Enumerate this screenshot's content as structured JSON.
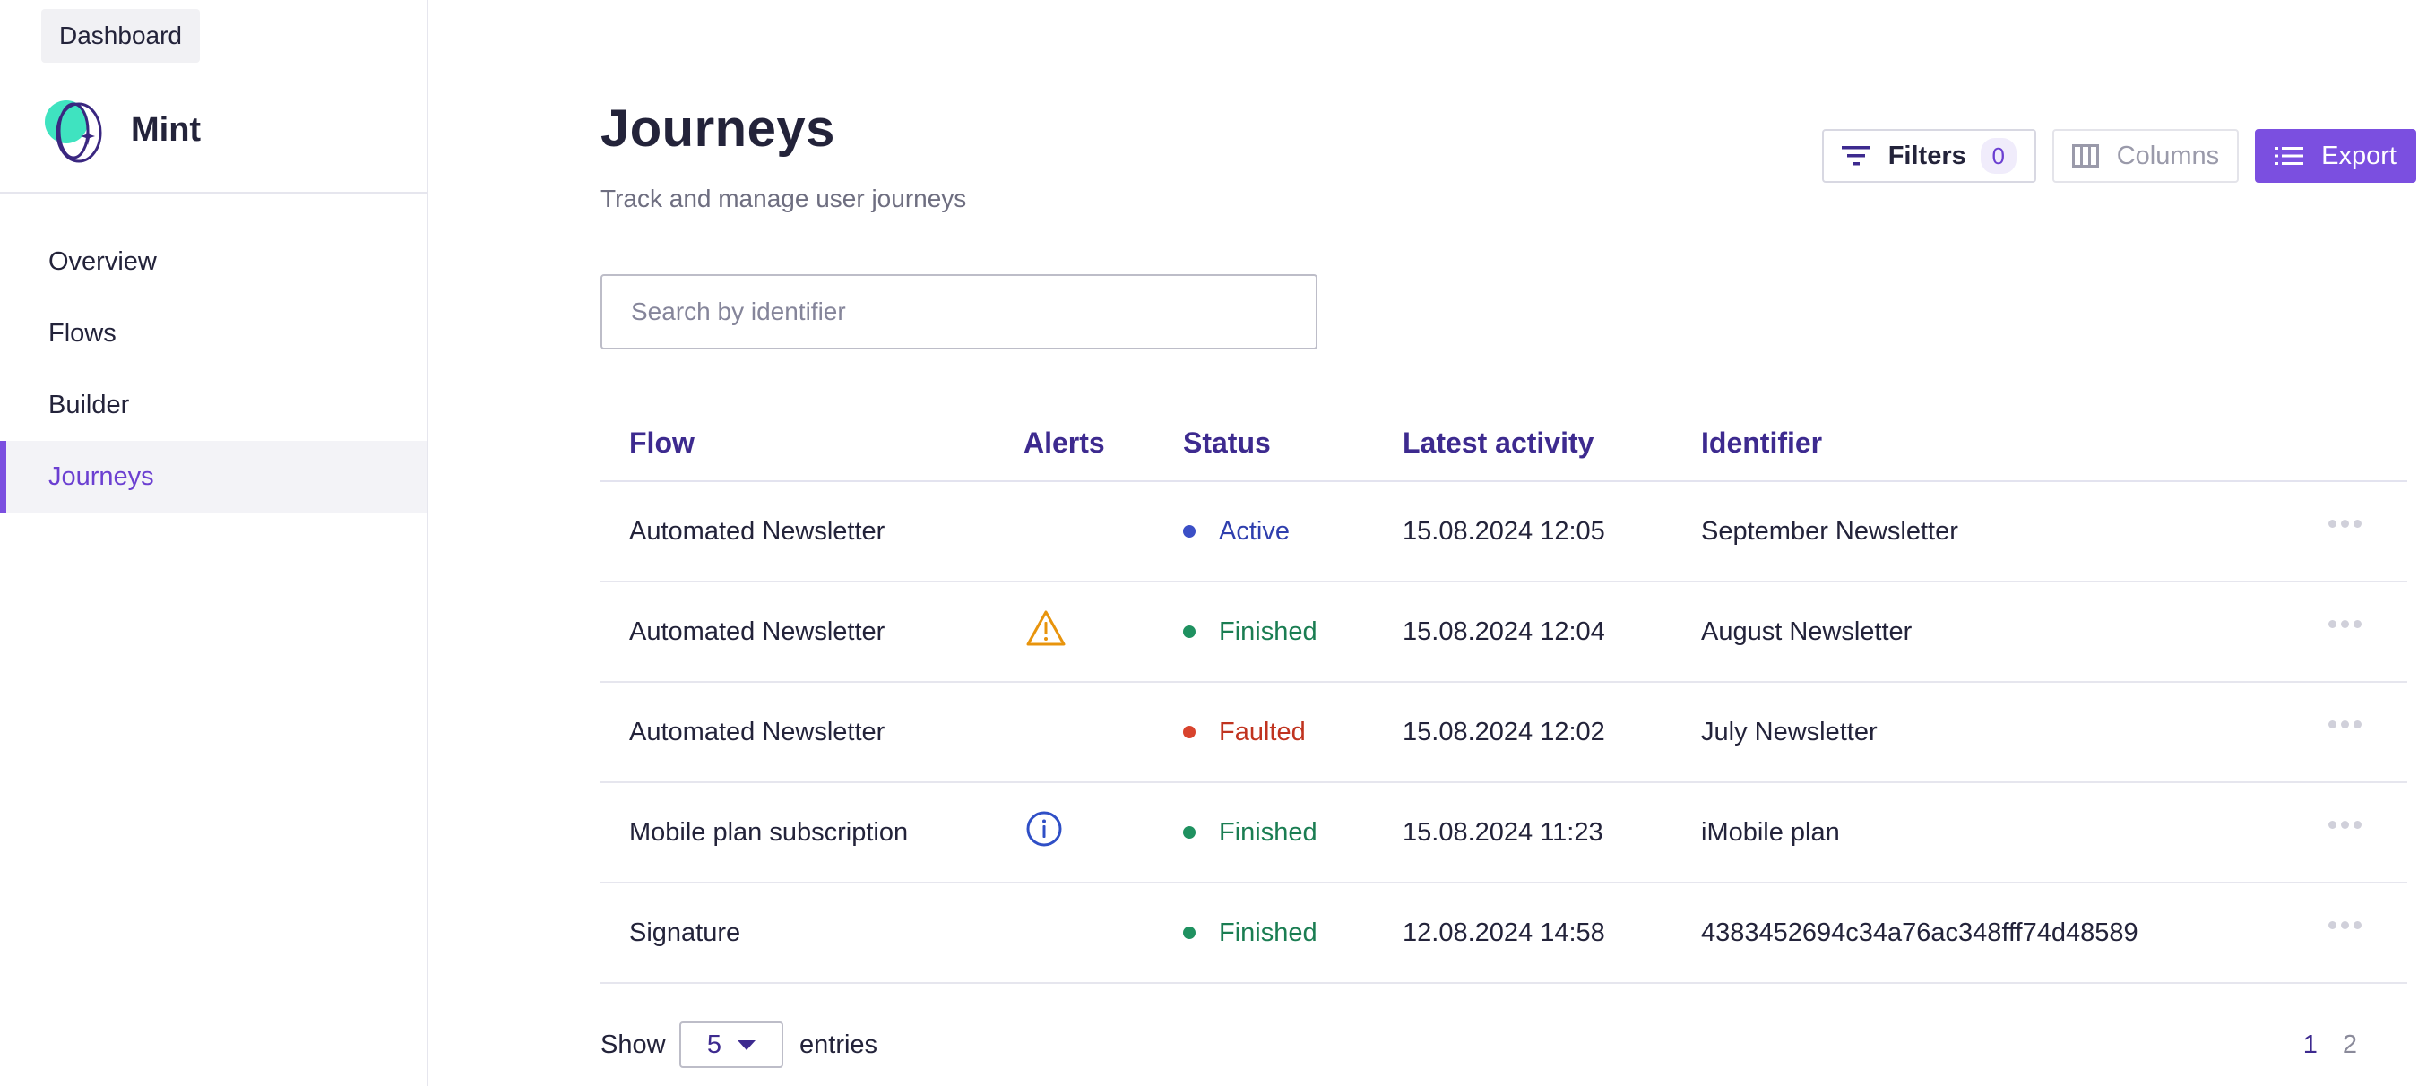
{
  "sidebar": {
    "dashboard_label": "Dashboard",
    "brand_name": "Mint",
    "items": [
      {
        "label": "Overview",
        "active": false
      },
      {
        "label": "Flows",
        "active": false
      },
      {
        "label": "Builder",
        "active": false
      },
      {
        "label": "Journeys",
        "active": true
      }
    ]
  },
  "header": {
    "title": "Journeys",
    "subtitle": "Track and manage user journeys"
  },
  "toolbar": {
    "filters_label": "Filters",
    "filters_count": "0",
    "columns_label": "Columns",
    "export_label": "Export"
  },
  "search": {
    "placeholder": "Search by identifier",
    "value": ""
  },
  "table": {
    "columns": [
      "Flow",
      "Alerts",
      "Status",
      "Latest activity",
      "Identifier"
    ],
    "rows": [
      {
        "flow": "Automated Newsletter",
        "alert": "",
        "status": "Active",
        "latest": "15.08.2024 12:05",
        "identifier": "September Newsletter"
      },
      {
        "flow": "Automated Newsletter",
        "alert": "warning-icon",
        "status": "Finished",
        "latest": "15.08.2024 12:04",
        "identifier": "August Newsletter"
      },
      {
        "flow": "Automated Newsletter",
        "alert": "",
        "status": "Faulted",
        "latest": "15.08.2024 12:02",
        "identifier": "July Newsletter"
      },
      {
        "flow": "Mobile plan subscription",
        "alert": "info-icon",
        "status": "Finished",
        "latest": "15.08.2024 11:23",
        "identifier": "iMobile plan"
      },
      {
        "flow": "Signature",
        "alert": "",
        "status": "Finished",
        "latest": "12.08.2024 14:58",
        "identifier": "4383452694c34a76ac348fff74d48589"
      }
    ]
  },
  "footer": {
    "show_label": "Show",
    "entries_value": "5",
    "entries_label": "entries",
    "pages": [
      "1",
      "2"
    ],
    "current_page": "1"
  },
  "colors": {
    "accent": "#7b4fe0",
    "header_text": "#3d2a8f",
    "status_active": "#3b4fc6",
    "status_finished": "#1f9160",
    "status_faulted": "#d8432d",
    "alert_warning": "#e8940c",
    "alert_info": "#2f4fc6"
  }
}
